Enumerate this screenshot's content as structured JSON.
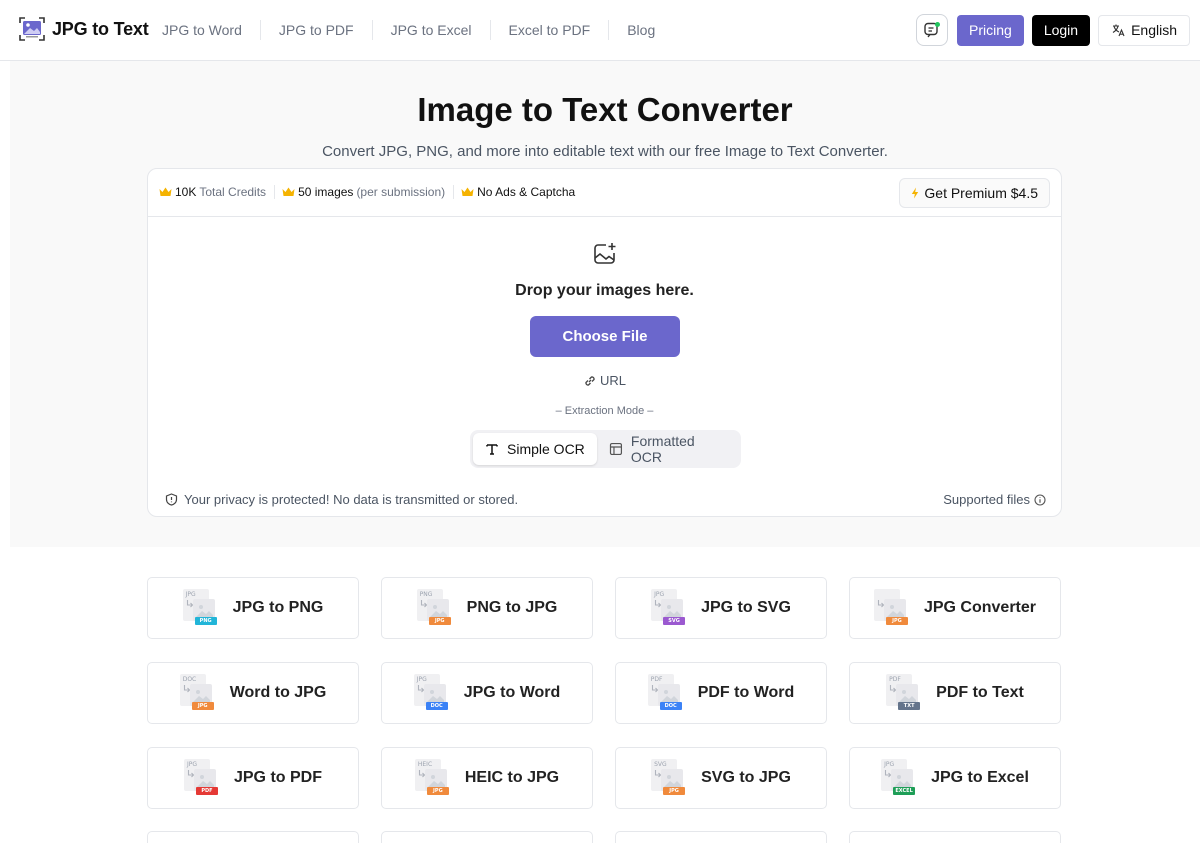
{
  "header": {
    "logo_text": "JPG to Text",
    "nav": [
      {
        "label": "JPG to Word"
      },
      {
        "label": "JPG to PDF"
      },
      {
        "label": "JPG to Excel"
      },
      {
        "label": "Excel to PDF"
      },
      {
        "label": "Blog"
      }
    ],
    "pricing_label": "Pricing",
    "login_label": "Login",
    "language_label": "English"
  },
  "hero": {
    "title": "Image to Text Converter",
    "subtitle": "Convert JPG, PNG, and more into editable text with our free Image to Text Converter."
  },
  "upload": {
    "features": [
      {
        "strong": "10K",
        "muted": "Total Credits"
      },
      {
        "strong": "50 images",
        "muted": "(per submission)"
      },
      {
        "strong": "No Ads & Captcha",
        "muted": ""
      }
    ],
    "premium_label": "Get Premium $4.5",
    "drop_text": "Drop your images here.",
    "choose_label": "Choose File",
    "url_label": "URL",
    "mode_label": "– Extraction Mode –",
    "modes": [
      {
        "label": "Simple OCR",
        "active": true
      },
      {
        "label": "Formatted OCR",
        "active": false
      }
    ],
    "privacy_text": "Your privacy is protected! No data is transmitted or stored.",
    "supported_label": "Supported files"
  },
  "tools": [
    {
      "label": "JPG to PNG",
      "from": "JPG",
      "to": "PNG",
      "color": "#22b5d8"
    },
    {
      "label": "PNG to JPG",
      "from": "PNG",
      "to": "JPG",
      "color": "#f08a3c"
    },
    {
      "label": "JPG to SVG",
      "from": "JPG",
      "to": "SVG",
      "color": "#9b59d0"
    },
    {
      "label": "JPG Converter",
      "from": "",
      "to": "JPG",
      "color": "#f08a3c"
    },
    {
      "label": "Word to JPG",
      "from": "DOC",
      "to": "JPG",
      "color": "#f08a3c"
    },
    {
      "label": "JPG to Word",
      "from": "JPG",
      "to": "DOC",
      "color": "#3b82f6"
    },
    {
      "label": "PDF to Word",
      "from": "PDF",
      "to": "DOC",
      "color": "#3b82f6"
    },
    {
      "label": "PDF to Text",
      "from": "PDF",
      "to": "TXT",
      "color": "#64748b"
    },
    {
      "label": "JPG to PDF",
      "from": "JPG",
      "to": "PDF",
      "color": "#e53935"
    },
    {
      "label": "HEIC to JPG",
      "from": "HEIC",
      "to": "JPG",
      "color": "#f08a3c"
    },
    {
      "label": "SVG to JPG",
      "from": "SVG",
      "to": "JPG",
      "color": "#f08a3c"
    },
    {
      "label": "JPG to Excel",
      "from": "JPG",
      "to": "EXCEL",
      "color": "#1e9e57"
    }
  ],
  "colors": {
    "accent": "#6b67cc",
    "crown": "#f5b301"
  }
}
